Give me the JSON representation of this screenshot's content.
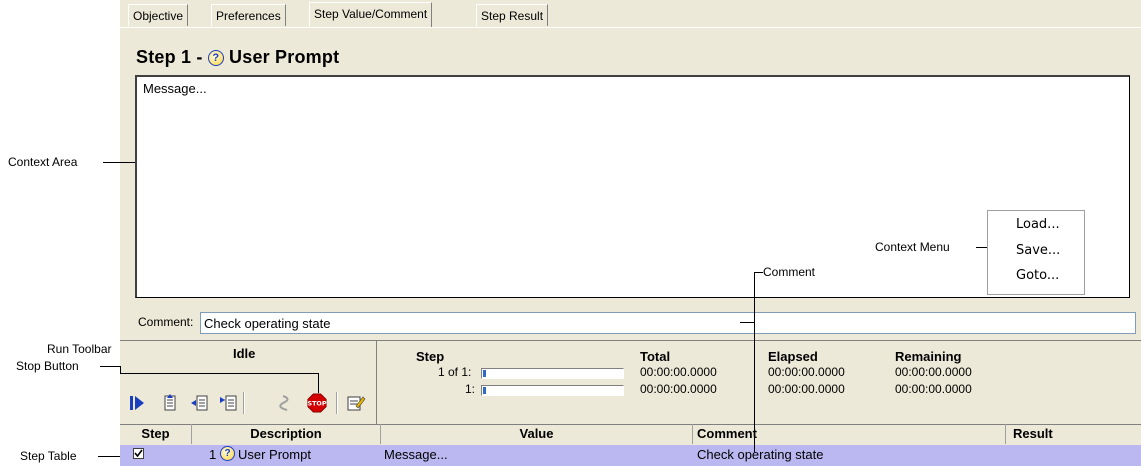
{
  "tabs": [
    {
      "label": "Objective",
      "active": false
    },
    {
      "label": "Preferences",
      "active": false
    },
    {
      "label": "Step Value/Comment",
      "active": true
    },
    {
      "label": "Step Result",
      "active": false
    }
  ],
  "step_title": {
    "prefix": "Step 1 -",
    "name": "User Prompt",
    "icon": "question-icon"
  },
  "message": {
    "text": "Message..."
  },
  "context_menu": {
    "items": [
      "Load...",
      "Save...",
      "Goto..."
    ]
  },
  "comment": {
    "label": "Comment:",
    "value": "Check operating state"
  },
  "run": {
    "state": "Idle",
    "headers": {
      "step": "Step",
      "total": "Total",
      "elapsed": "Elapsed",
      "remaining": "Remaining"
    },
    "rows": [
      {
        "step": "1 of 1:",
        "total": "00:00:00.0000",
        "elapsed": "00:00:00.0000",
        "remaining": "00:00:00.0000",
        "progress": 0.02
      },
      {
        "step": "1:",
        "total": "00:00:00.0000",
        "elapsed": "00:00:00.0000",
        "remaining": "00:00:00.0000",
        "progress": 0.02
      }
    ],
    "toolbar": [
      "run-icon",
      "step-into-icon",
      "step-over-icon",
      "step-out-icon",
      "skip-icon",
      "stop-icon",
      "edit-icon"
    ],
    "stop_label": "STOP"
  },
  "table": {
    "columns": [
      "Step",
      "Description",
      "Value",
      "Comment",
      "Result"
    ],
    "rows": [
      {
        "checked": true,
        "step": "1",
        "description": "User Prompt",
        "value": "Message...",
        "comment": "Check operating state",
        "result": ""
      }
    ]
  },
  "annotations": {
    "context_area": "Context Area",
    "context_menu": "Context Menu",
    "comment": "Comment",
    "run_toolbar": "Run Toolbar",
    "stop_button": "Stop Button",
    "step_table": "Step Table"
  },
  "colors": {
    "panel": "#ece9d8",
    "row_highlight": "#bbb7f0",
    "progress": "#316ac5",
    "run_blue": "#1a3ec0",
    "stop_red": "#d40000"
  }
}
